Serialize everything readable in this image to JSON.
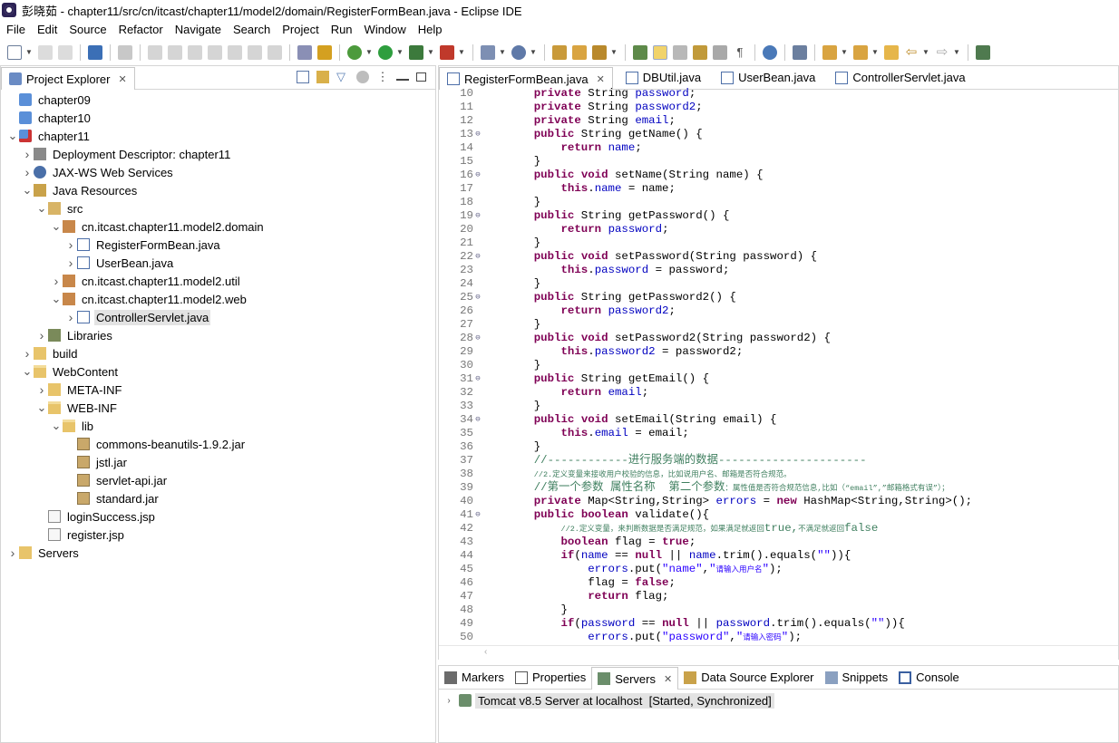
{
  "window": {
    "title": "彭晓茹 - chapter11/src/cn/itcast/chapter11/model2/domain/RegisterFormBean.java - Eclipse IDE"
  },
  "menu": [
    "File",
    "Edit",
    "Source",
    "Refactor",
    "Navigate",
    "Search",
    "Project",
    "Run",
    "Window",
    "Help"
  ],
  "project_explorer": {
    "title": "Project Explorer",
    "items": [
      {
        "label": "chapter09",
        "depth": 0,
        "twisty": "",
        "icon": "folder-project-icon"
      },
      {
        "label": "chapter10",
        "depth": 0,
        "twisty": "",
        "icon": "folder-project-icon"
      },
      {
        "label": "chapter11",
        "depth": 0,
        "twisty": "v",
        "icon": "web-project-icon"
      },
      {
        "label": "Deployment Descriptor: chapter11",
        "depth": 1,
        "twisty": ">",
        "icon": "deployment-descriptor-icon"
      },
      {
        "label": "JAX-WS Web Services",
        "depth": 1,
        "twisty": ">",
        "icon": "web-services-icon"
      },
      {
        "label": "Java Resources",
        "depth": 1,
        "twisty": "v",
        "icon": "java-resources-icon"
      },
      {
        "label": "src",
        "depth": 2,
        "twisty": "v",
        "icon": "source-folder-icon"
      },
      {
        "label": "cn.itcast.chapter11.model2.domain",
        "depth": 3,
        "twisty": "v",
        "icon": "package-icon"
      },
      {
        "label": "RegisterFormBean.java",
        "depth": 4,
        "twisty": ">",
        "icon": "java-file-icon"
      },
      {
        "label": "UserBean.java",
        "depth": 4,
        "twisty": ">",
        "icon": "java-file-icon"
      },
      {
        "label": "cn.itcast.chapter11.model2.util",
        "depth": 3,
        "twisty": ">",
        "icon": "package-icon"
      },
      {
        "label": "cn.itcast.chapter11.model2.web",
        "depth": 3,
        "twisty": "v",
        "icon": "package-icon"
      },
      {
        "label": "ControllerServlet.java",
        "depth": 4,
        "twisty": ">",
        "icon": "java-file-icon",
        "selected": true
      },
      {
        "label": "Libraries",
        "depth": 2,
        "twisty": ">",
        "icon": "libraries-icon"
      },
      {
        "label": "build",
        "depth": 1,
        "twisty": ">",
        "icon": "folder-icon"
      },
      {
        "label": "WebContent",
        "depth": 1,
        "twisty": "v",
        "icon": "folder-open-icon"
      },
      {
        "label": "META-INF",
        "depth": 2,
        "twisty": ">",
        "icon": "folder-icon"
      },
      {
        "label": "WEB-INF",
        "depth": 2,
        "twisty": "v",
        "icon": "folder-open-icon"
      },
      {
        "label": "lib",
        "depth": 3,
        "twisty": "v",
        "icon": "folder-open-icon"
      },
      {
        "label": "commons-beanutils-1.9.2.jar",
        "depth": 4,
        "twisty": "",
        "icon": "jar-icon"
      },
      {
        "label": "jstl.jar",
        "depth": 4,
        "twisty": "",
        "icon": "jar-icon"
      },
      {
        "label": "servlet-api.jar",
        "depth": 4,
        "twisty": "",
        "icon": "jar-icon"
      },
      {
        "label": "standard.jar",
        "depth": 4,
        "twisty": "",
        "icon": "jar-icon"
      },
      {
        "label": "loginSuccess.jsp",
        "depth": 2,
        "twisty": "",
        "icon": "jsp-file-icon"
      },
      {
        "label": "register.jsp",
        "depth": 2,
        "twisty": "",
        "icon": "jsp-file-icon"
      },
      {
        "label": "Servers",
        "depth": 0,
        "twisty": ">",
        "icon": "folder-icon"
      }
    ]
  },
  "editor": {
    "tabs": [
      {
        "label": "RegisterFormBean.java",
        "active": true,
        "closable": true
      },
      {
        "label": "DBUtil.java"
      },
      {
        "label": "UserBean.java"
      },
      {
        "label": "ControllerServlet.java"
      }
    ],
    "lines": [
      {
        "n": "10",
        "fold": "",
        "t": [
          [
            "    ",
            ""
          ],
          [
            "private",
            "kw"
          ],
          [
            " String ",
            ""
          ],
          [
            "password",
            "fd"
          ],
          [
            ";",
            ""
          ]
        ]
      },
      {
        "n": "11",
        "fold": "",
        "t": [
          [
            "    ",
            ""
          ],
          [
            "private",
            "kw"
          ],
          [
            " String ",
            ""
          ],
          [
            "password2",
            "fd"
          ],
          [
            ";",
            ""
          ]
        ]
      },
      {
        "n": "12",
        "fold": "",
        "t": [
          [
            "    ",
            ""
          ],
          [
            "private",
            "kw"
          ],
          [
            " String ",
            ""
          ],
          [
            "email",
            "fd"
          ],
          [
            ";",
            ""
          ]
        ]
      },
      {
        "n": "13",
        "fold": "⊖",
        "t": [
          [
            "    ",
            ""
          ],
          [
            "public",
            "kw"
          ],
          [
            " String getName() {",
            ""
          ]
        ]
      },
      {
        "n": "14",
        "fold": "",
        "t": [
          [
            "        ",
            ""
          ],
          [
            "return",
            "kw"
          ],
          [
            " ",
            ""
          ],
          [
            "name",
            "fd"
          ],
          [
            ";",
            ""
          ]
        ]
      },
      {
        "n": "15",
        "fold": "",
        "t": [
          [
            "    }",
            ""
          ]
        ]
      },
      {
        "n": "16",
        "fold": "⊖",
        "t": [
          [
            "    ",
            ""
          ],
          [
            "public",
            "kw"
          ],
          [
            " ",
            ""
          ],
          [
            "void",
            "kw"
          ],
          [
            " setName(String name) {",
            ""
          ]
        ]
      },
      {
        "n": "17",
        "fold": "",
        "t": [
          [
            "        ",
            ""
          ],
          [
            "this",
            "kw"
          ],
          [
            ".",
            ""
          ],
          [
            "name",
            "fd"
          ],
          [
            " = name;",
            ""
          ]
        ]
      },
      {
        "n": "18",
        "fold": "",
        "t": [
          [
            "    }",
            ""
          ]
        ]
      },
      {
        "n": "19",
        "fold": "⊖",
        "t": [
          [
            "    ",
            ""
          ],
          [
            "public",
            "kw"
          ],
          [
            " String getPassword() {",
            ""
          ]
        ]
      },
      {
        "n": "20",
        "fold": "",
        "t": [
          [
            "        ",
            ""
          ],
          [
            "return",
            "kw"
          ],
          [
            " ",
            ""
          ],
          [
            "password",
            "fd"
          ],
          [
            ";",
            ""
          ]
        ]
      },
      {
        "n": "21",
        "fold": "",
        "t": [
          [
            "    }",
            ""
          ]
        ]
      },
      {
        "n": "22",
        "fold": "⊖",
        "t": [
          [
            "    ",
            ""
          ],
          [
            "public",
            "kw"
          ],
          [
            " ",
            ""
          ],
          [
            "void",
            "kw"
          ],
          [
            " setPassword(String password) {",
            ""
          ]
        ]
      },
      {
        "n": "23",
        "fold": "",
        "t": [
          [
            "        ",
            ""
          ],
          [
            "this",
            "kw"
          ],
          [
            ".",
            ""
          ],
          [
            "password",
            "fd"
          ],
          [
            " = password;",
            ""
          ]
        ]
      },
      {
        "n": "24",
        "fold": "",
        "t": [
          [
            "    }",
            ""
          ]
        ]
      },
      {
        "n": "25",
        "fold": "⊖",
        "t": [
          [
            "    ",
            ""
          ],
          [
            "public",
            "kw"
          ],
          [
            " String getPassword2() {",
            ""
          ]
        ]
      },
      {
        "n": "26",
        "fold": "",
        "t": [
          [
            "        ",
            ""
          ],
          [
            "return",
            "kw"
          ],
          [
            " ",
            ""
          ],
          [
            "password2",
            "fd"
          ],
          [
            ";",
            ""
          ]
        ]
      },
      {
        "n": "27",
        "fold": "",
        "t": [
          [
            "    }",
            ""
          ]
        ]
      },
      {
        "n": "28",
        "fold": "⊖",
        "t": [
          [
            "    ",
            ""
          ],
          [
            "public",
            "kw"
          ],
          [
            " ",
            ""
          ],
          [
            "void",
            "kw"
          ],
          [
            " setPassword2(String password2) {",
            ""
          ]
        ]
      },
      {
        "n": "29",
        "fold": "",
        "t": [
          [
            "        ",
            ""
          ],
          [
            "this",
            "kw"
          ],
          [
            ".",
            ""
          ],
          [
            "password2",
            "fd"
          ],
          [
            " = password2;",
            ""
          ]
        ]
      },
      {
        "n": "30",
        "fold": "",
        "t": [
          [
            "    }",
            ""
          ]
        ]
      },
      {
        "n": "31",
        "fold": "⊖",
        "t": [
          [
            "    ",
            ""
          ],
          [
            "public",
            "kw"
          ],
          [
            " String getEmail() {",
            ""
          ]
        ]
      },
      {
        "n": "32",
        "fold": "",
        "t": [
          [
            "        ",
            ""
          ],
          [
            "return",
            "kw"
          ],
          [
            " ",
            ""
          ],
          [
            "email",
            "fd"
          ],
          [
            ";",
            ""
          ]
        ]
      },
      {
        "n": "33",
        "fold": "",
        "t": [
          [
            "    }",
            ""
          ]
        ]
      },
      {
        "n": "34",
        "fold": "⊖",
        "t": [
          [
            "    ",
            ""
          ],
          [
            "public",
            "kw"
          ],
          [
            " ",
            ""
          ],
          [
            "void",
            "kw"
          ],
          [
            " setEmail(String email) {",
            ""
          ]
        ]
      },
      {
        "n": "35",
        "fold": "",
        "t": [
          [
            "        ",
            ""
          ],
          [
            "this",
            "kw"
          ],
          [
            ".",
            ""
          ],
          [
            "email",
            "fd"
          ],
          [
            " = email;",
            ""
          ]
        ]
      },
      {
        "n": "36",
        "fold": "",
        "t": [
          [
            "    }",
            ""
          ]
        ]
      },
      {
        "n": "37",
        "fold": "",
        "t": [
          [
            "    //------------进行服务端的数据----------------------",
            "cm"
          ]
        ]
      },
      {
        "n": "38",
        "fold": "",
        "t": [
          [
            "    ",
            ""
          ],
          [
            "//2.定义变量来接收用户校验的信息，比如说用户名、邮箱是否符合规范。",
            "cmsmall"
          ]
        ]
      },
      {
        "n": "39",
        "fold": "",
        "t": [
          [
            "    //第一个参数 属性名称  第二个参数",
            "cm"
          ],
          [
            "：属性值是否符合规范信息,比如（“email”,”邮箱格式有误”）；",
            "cmsmall"
          ]
        ]
      },
      {
        "n": "40",
        "fold": "",
        "t": [
          [
            "    ",
            ""
          ],
          [
            "private",
            "kw"
          ],
          [
            " Map<String,String> ",
            ""
          ],
          [
            "errors",
            "fd"
          ],
          [
            " = ",
            ""
          ],
          [
            "new",
            "kw"
          ],
          [
            " HashMap<String,String>();",
            ""
          ]
        ]
      },
      {
        "n": "41",
        "fold": "⊖",
        "t": [
          [
            "    ",
            ""
          ],
          [
            "public",
            "kw"
          ],
          [
            " ",
            ""
          ],
          [
            "boolean",
            "kw"
          ],
          [
            " validate(){",
            ""
          ]
        ]
      },
      {
        "n": "42",
        "fold": "",
        "t": [
          [
            "        ",
            ""
          ],
          [
            "//2.定义变量，来判断数据是否满足规范，如果满足就返回",
            "cmsmall"
          ],
          [
            "true,",
            "cm"
          ],
          [
            "不满足就返回",
            "cmsmall"
          ],
          [
            "false",
            "cm"
          ]
        ]
      },
      {
        "n": "43",
        "fold": "",
        "t": [
          [
            "        ",
            ""
          ],
          [
            "boolean",
            "kw"
          ],
          [
            " flag = ",
            ""
          ],
          [
            "true",
            "kw"
          ],
          [
            ";",
            ""
          ]
        ]
      },
      {
        "n": "44",
        "fold": "",
        "t": [
          [
            "        ",
            ""
          ],
          [
            "if",
            "kw"
          ],
          [
            "(",
            ""
          ],
          [
            "name",
            "fd"
          ],
          [
            " == ",
            ""
          ],
          [
            "null",
            "kw"
          ],
          [
            " || ",
            ""
          ],
          [
            "name",
            "fd"
          ],
          [
            ".trim().equals(",
            ""
          ],
          [
            "\"\"",
            "st"
          ],
          [
            ")){",
            ""
          ]
        ]
      },
      {
        "n": "45",
        "fold": "",
        "t": [
          [
            "            ",
            ""
          ],
          [
            "errors",
            "fd"
          ],
          [
            ".put(",
            ""
          ],
          [
            "\"name\"",
            "st"
          ],
          [
            ",",
            ""
          ],
          [
            "\"",
            "st"
          ],
          [
            "请输入用户名",
            "stsmall"
          ],
          [
            "\"",
            "st"
          ],
          [
            ");",
            ""
          ]
        ]
      },
      {
        "n": "46",
        "fold": "",
        "t": [
          [
            "            flag = ",
            ""
          ],
          [
            "false",
            "kw"
          ],
          [
            ";",
            ""
          ]
        ]
      },
      {
        "n": "47",
        "fold": "",
        "t": [
          [
            "            ",
            ""
          ],
          [
            "return",
            "kw"
          ],
          [
            " flag;",
            ""
          ]
        ]
      },
      {
        "n": "48",
        "fold": "",
        "t": [
          [
            "        }",
            ""
          ]
        ]
      },
      {
        "n": "49",
        "fold": "",
        "t": [
          [
            "        ",
            ""
          ],
          [
            "if",
            "kw"
          ],
          [
            "(",
            ""
          ],
          [
            "password",
            "fd"
          ],
          [
            " == ",
            ""
          ],
          [
            "null",
            "kw"
          ],
          [
            " || ",
            ""
          ],
          [
            "password",
            "fd"
          ],
          [
            ".trim().equals(",
            ""
          ],
          [
            "\"\"",
            "st"
          ],
          [
            ")){",
            ""
          ]
        ]
      },
      {
        "n": "50",
        "fold": "",
        "t": [
          [
            "            ",
            ""
          ],
          [
            "errors",
            "fd"
          ],
          [
            ".put(",
            ""
          ],
          [
            "\"password\"",
            "st"
          ],
          [
            ",",
            ""
          ],
          [
            "\"",
            "st"
          ],
          [
            "请输入密码",
            "stsmall"
          ],
          [
            "\"",
            "st"
          ],
          [
            ");",
            ""
          ]
        ]
      }
    ]
  },
  "bottom_panel": {
    "tabs": [
      {
        "label": "Markers",
        "icon": "markers-icon"
      },
      {
        "label": "Properties",
        "icon": "properties-icon"
      },
      {
        "label": "Servers",
        "icon": "servers-icon",
        "active": true,
        "closable": true
      },
      {
        "label": "Data Source Explorer",
        "icon": "data-source-icon"
      },
      {
        "label": "Snippets",
        "icon": "snippets-icon"
      },
      {
        "label": "Console",
        "icon": "console-icon"
      }
    ],
    "server": {
      "name": "Tomcat v8.5 Server at localhost",
      "status": "[Started, Synchronized]"
    }
  },
  "colors": {
    "keyword": "#7f0055",
    "field": "#0000c0",
    "comment": "#3f7f5f",
    "string": "#2a00ff"
  }
}
